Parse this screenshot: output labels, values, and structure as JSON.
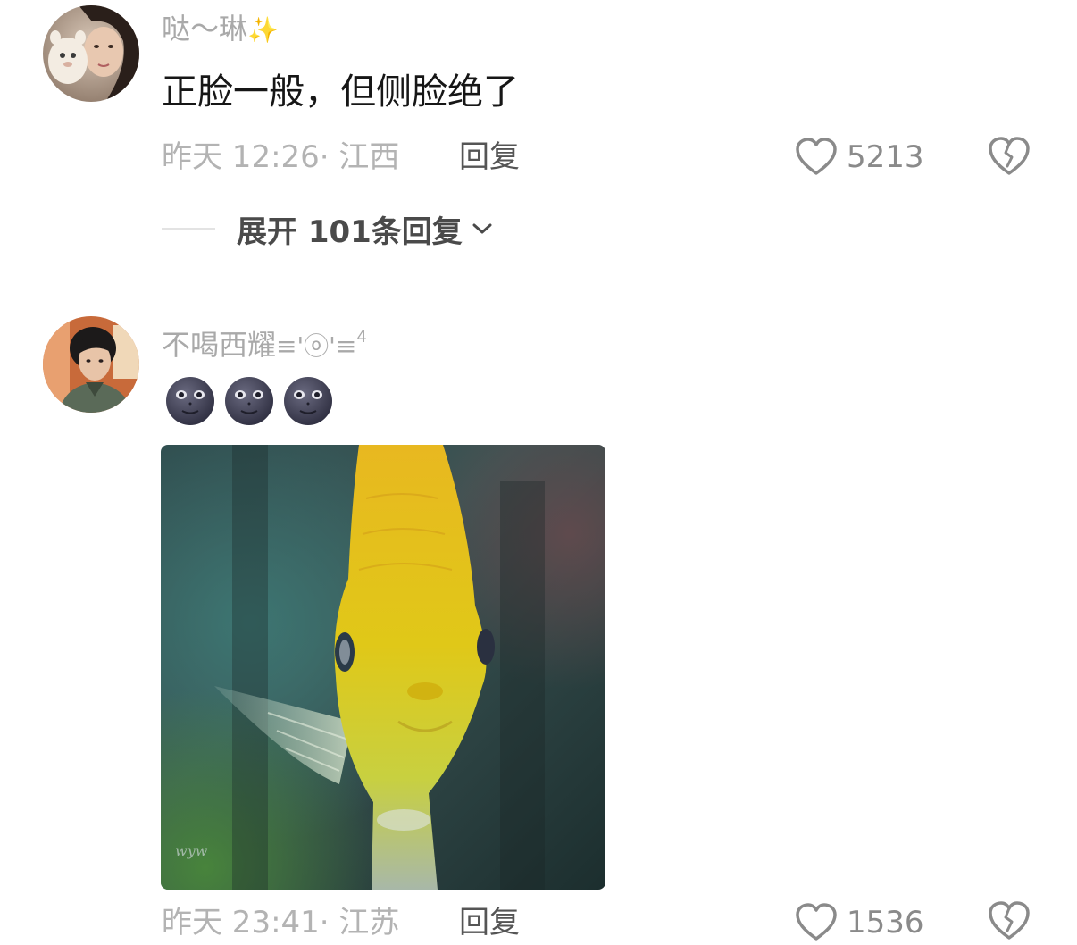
{
  "comments": [
    {
      "username": "哒～琳",
      "username_deco": "✨",
      "text": "正脸一般，但侧脸绝了",
      "meta": "昨天 12:26· 江西",
      "reply_label": "回复",
      "like_count": "5213",
      "expand_label": "展开 101条回复"
    },
    {
      "username": "不喝西耀",
      "username_deco": "≡'ⓞ'≡",
      "username_sup": "4",
      "emoji": [
        "new-moon-face",
        "new-moon-face",
        "new-moon-face"
      ],
      "image_watermark": "wyw",
      "meta": "昨天 23:41· 江苏",
      "reply_label": "回复",
      "like_count": "1536"
    }
  ],
  "colors": {
    "username": "#a9a9a9",
    "text": "#161616",
    "meta": "#b3b3b3",
    "icon": "#8a8a8a"
  },
  "icons": [
    "heart-outline-icon",
    "broken-heart-icon",
    "chevron-down-icon"
  ]
}
